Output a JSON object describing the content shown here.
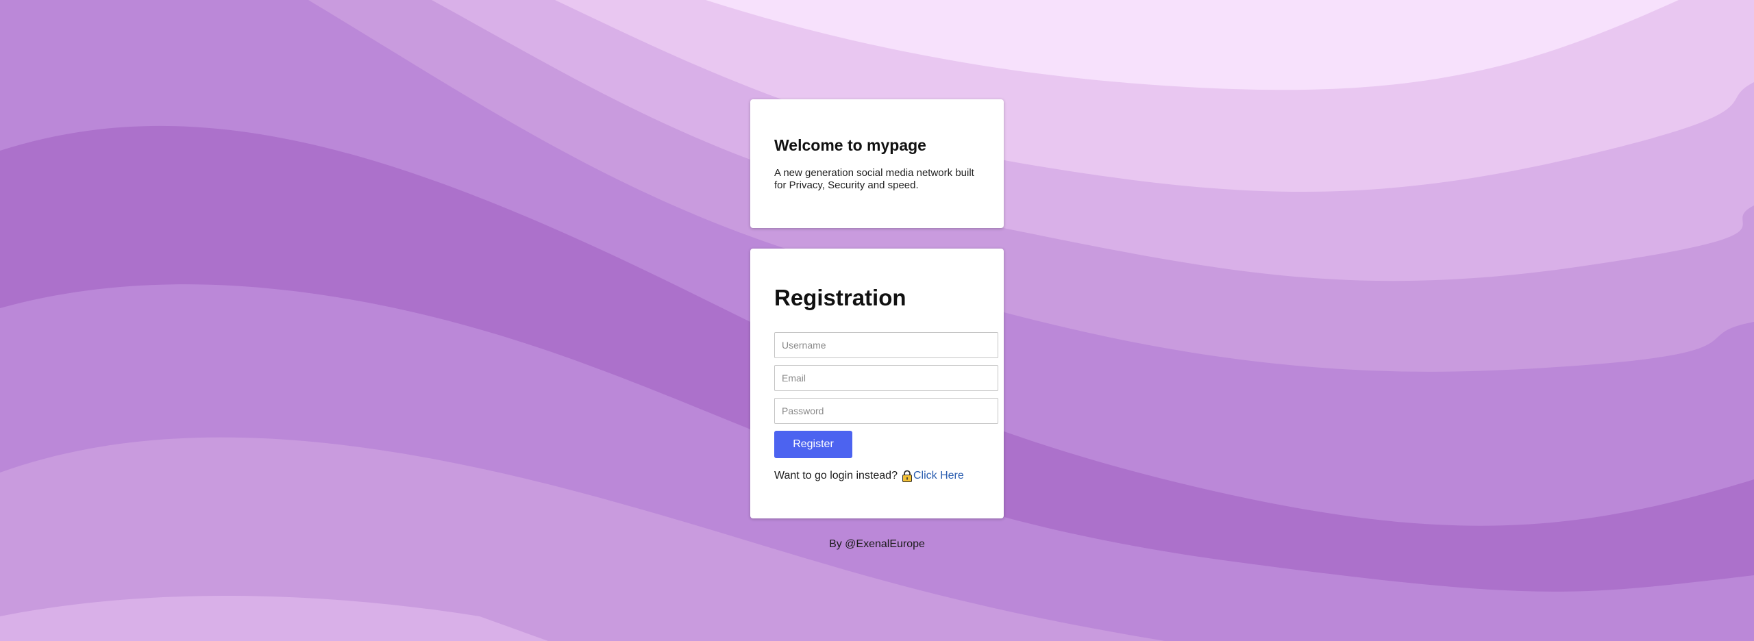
{
  "welcome": {
    "title": "Welcome to mypage",
    "description": "A new generation social media network built for Privacy, Security and speed."
  },
  "registration": {
    "title": "Registration",
    "username": {
      "placeholder": "Username",
      "value": ""
    },
    "email": {
      "placeholder": "Email",
      "value": ""
    },
    "password": {
      "placeholder": "Password",
      "value": ""
    },
    "register_label": "Register",
    "login_prompt": "Want to go login instead?",
    "login_icon": "lock-icon",
    "login_link": "Click Here"
  },
  "footer": {
    "credit": "By @ExenalEurope"
  },
  "colors": {
    "accent": "#4c63f0",
    "link": "#2a5db0",
    "background_waves": [
      "#f7e1fc",
      "#e9c7f1",
      "#d9b0e8",
      "#c99bde",
      "#bb88d8",
      "#ac71cb"
    ]
  }
}
